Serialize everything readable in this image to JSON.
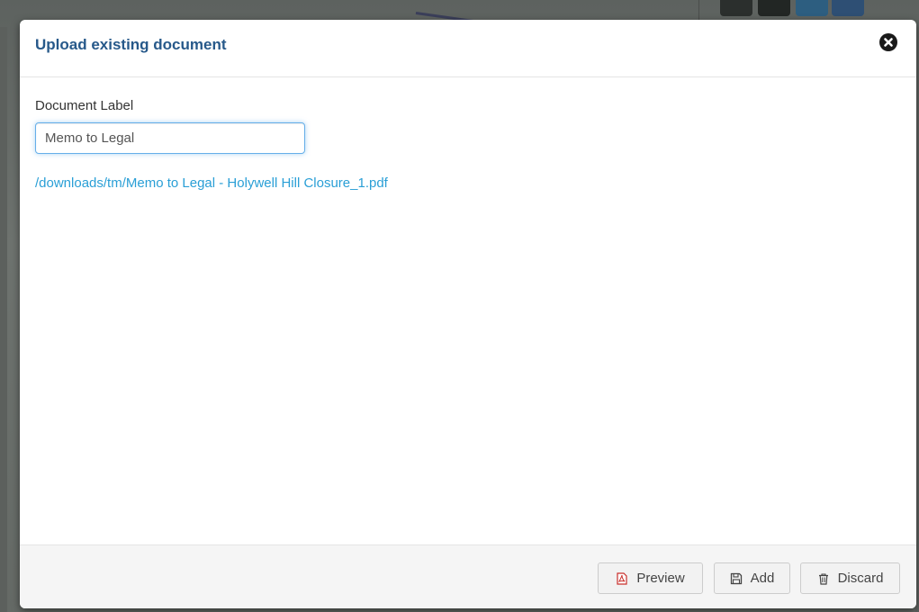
{
  "modal": {
    "title": "Upload existing document",
    "close_icon": "close-circle-icon"
  },
  "form": {
    "label_caption": "Document Label",
    "label_value": "Memo to Legal",
    "file_path": "/downloads/tm/Memo to Legal - Holywell Hill Closure_1.pdf"
  },
  "footer": {
    "buttons": [
      {
        "label": "Preview",
        "icon": "pdf-file-icon"
      },
      {
        "label": "Add",
        "icon": "floppy-disk-icon"
      },
      {
        "label": "Discard",
        "icon": "trash-icon"
      }
    ]
  },
  "colors": {
    "title": "#27598a",
    "link": "#2a9fd6",
    "input_focus_border": "#66afe9",
    "pdf_icon": "#c9302c",
    "footer_bg": "#f5f5f5"
  }
}
